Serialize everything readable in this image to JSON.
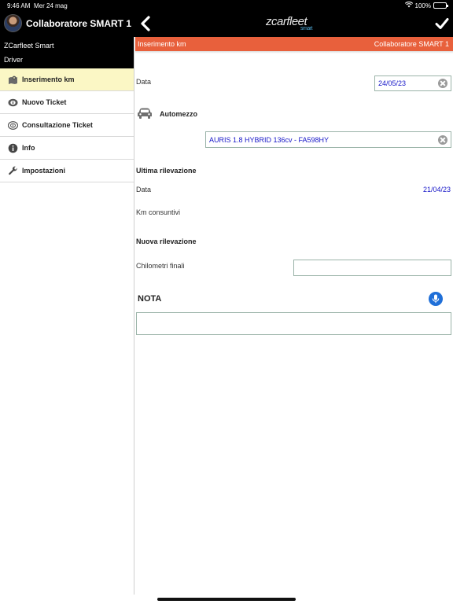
{
  "status": {
    "time": "9:46 AM",
    "date": "Mer 24 mag",
    "battery": "100%"
  },
  "header": {
    "user_title": "Collaboratore SMART 1",
    "logo_main": "zcarfleet",
    "logo_sub": "smart"
  },
  "sidebar": {
    "app_name": "ZCarfleet Smart",
    "role": "Driver",
    "items": [
      {
        "label": "Inserimento km",
        "icon": "map-pin-icon",
        "active": true
      },
      {
        "label": "Nuovo Ticket",
        "icon": "ticket-icon",
        "active": false
      },
      {
        "label": "Consultazione Ticket",
        "icon": "ticket-search-icon",
        "active": false
      },
      {
        "label": "Info",
        "icon": "info-icon",
        "active": false
      },
      {
        "label": "Impostazioni",
        "icon": "wrench-icon",
        "active": false
      }
    ]
  },
  "strip": {
    "left": "Inserimento km",
    "right": "Collaboratore SMART 1"
  },
  "form": {
    "data_label": "Data",
    "data_value": "24/05/23",
    "automezzo_label": "Automezzo",
    "automezzo_value": "AURIS 1.8 HYBRID 136cv - FA598HY",
    "ultima_title": "Ultima rilevazione",
    "ultima_data_label": "Data",
    "ultima_data_value": "21/04/23",
    "km_consuntivi_label": "Km consuntivi",
    "nuova_title": "Nuova rilevazione",
    "chilometri_label": "Chilometri finali",
    "chilometri_value": "",
    "nota_title": "NOTA",
    "nota_value": ""
  },
  "colors": {
    "accent": "#e8603c",
    "active_row": "#fbf7c5",
    "value_blue": "#1616c8",
    "mic": "#1f6fd8"
  }
}
